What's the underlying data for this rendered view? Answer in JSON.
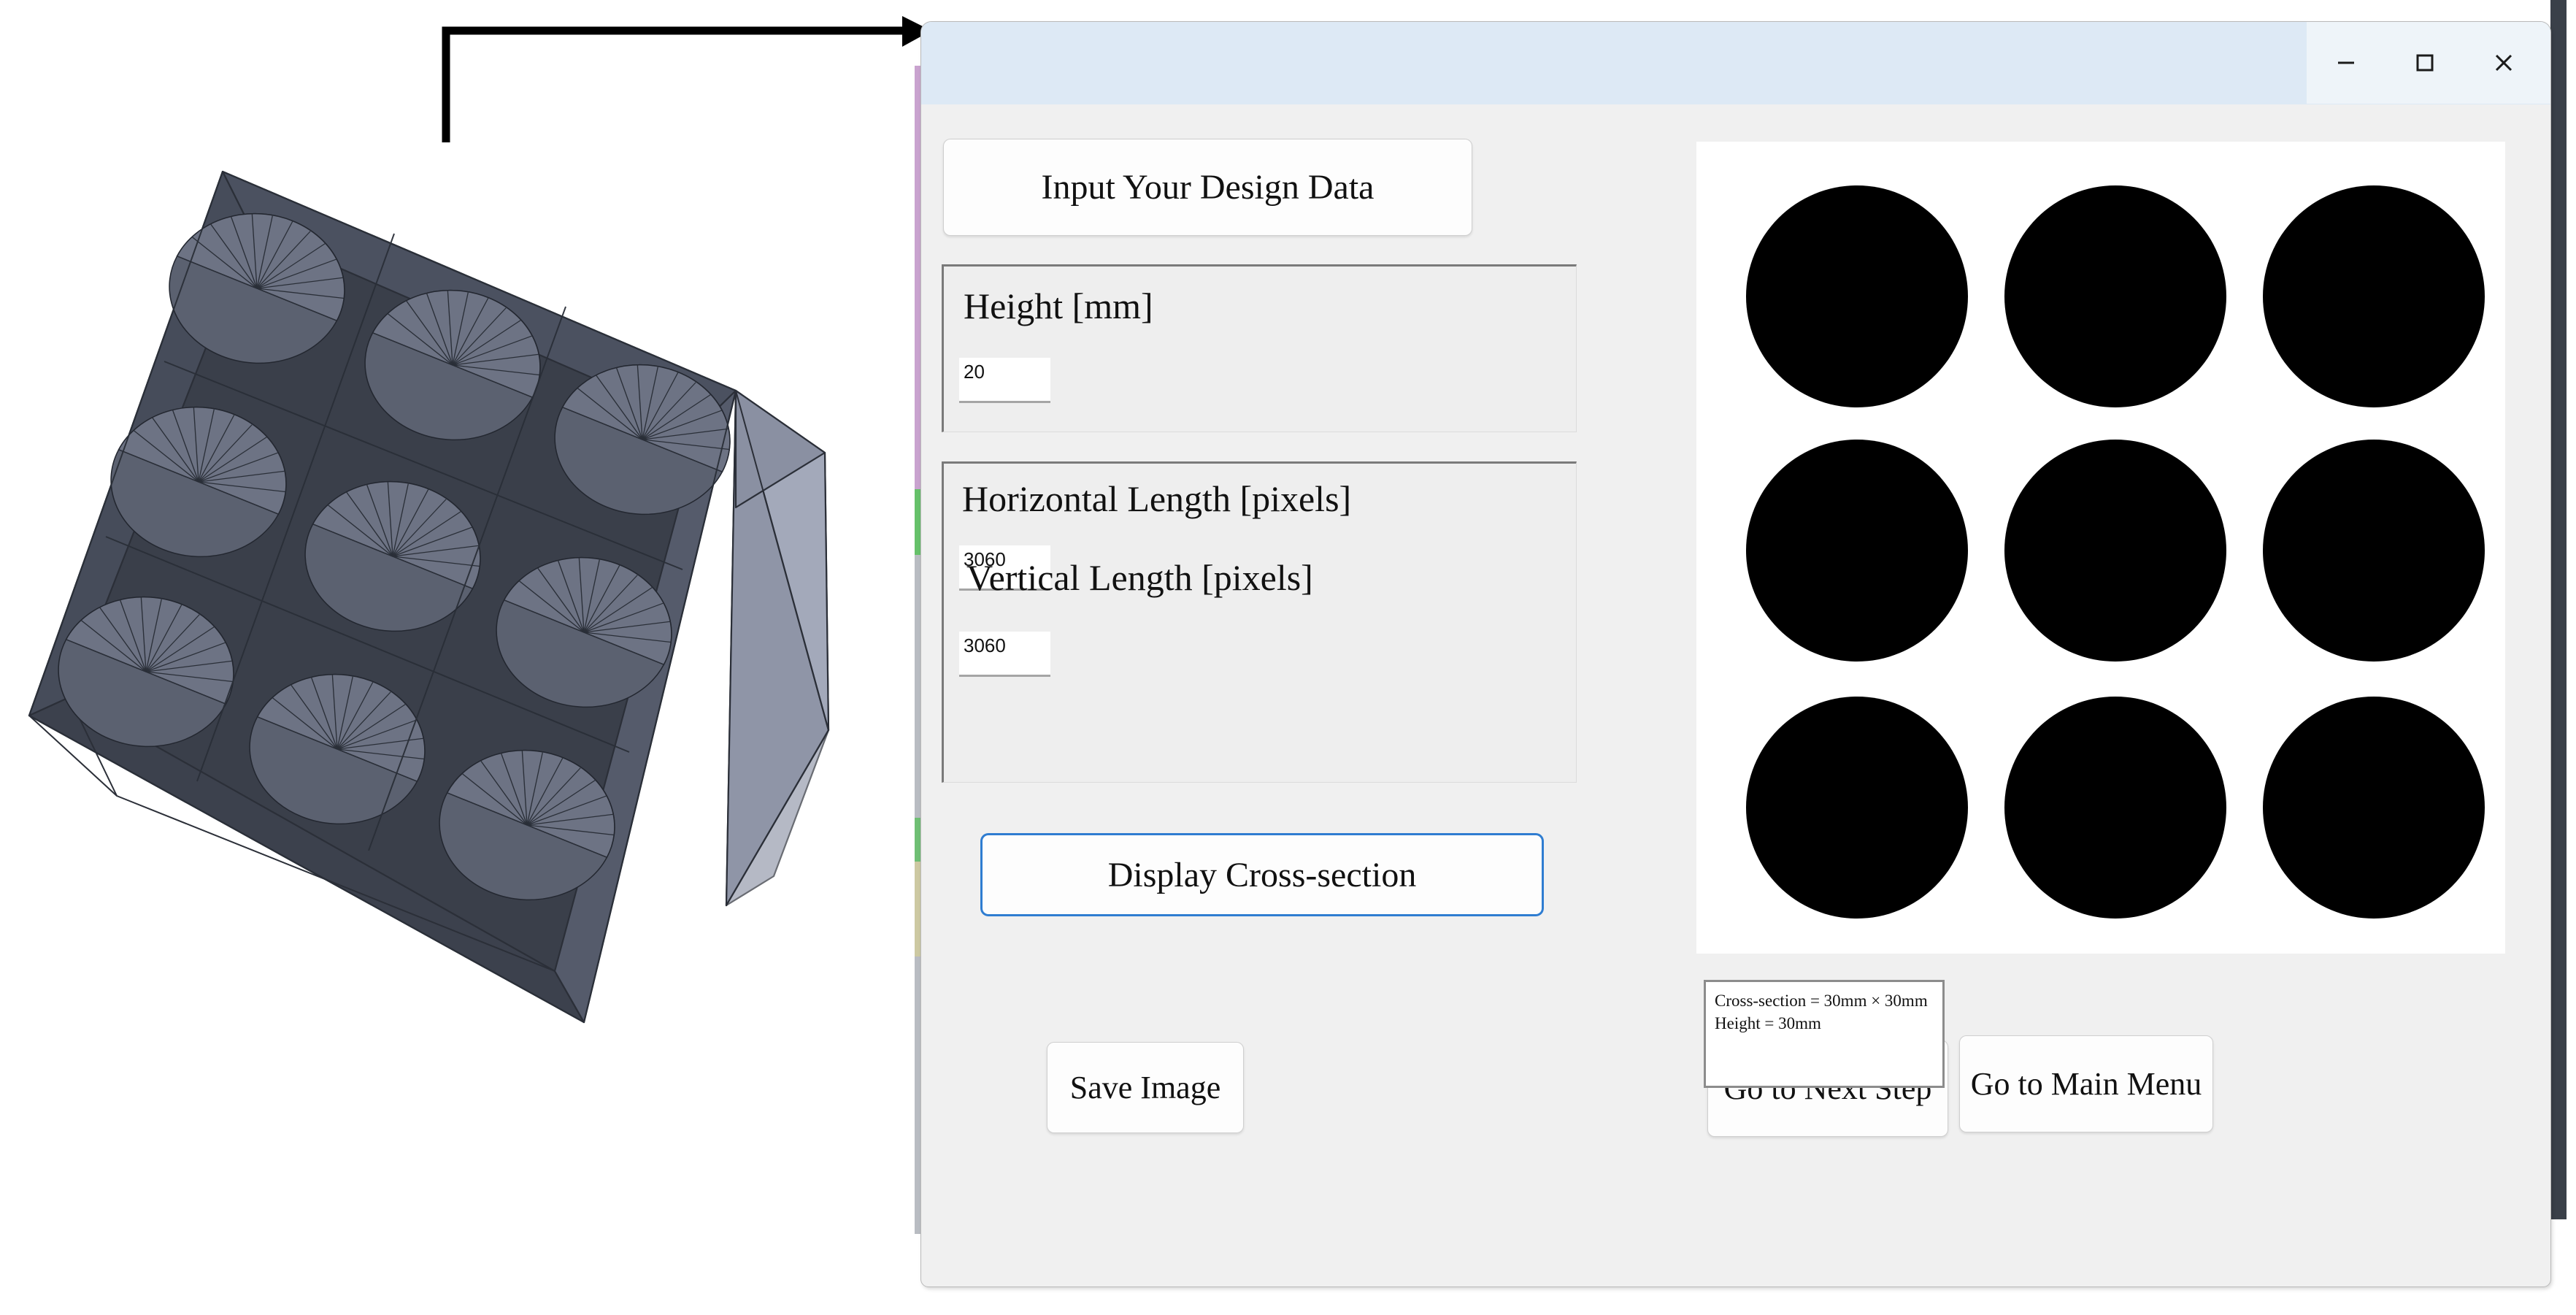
{
  "window": {
    "title": "",
    "controls": [
      {
        "name": "minimize",
        "glyph": "minimize-icon"
      },
      {
        "name": "maximize",
        "glyph": "maximize-icon"
      },
      {
        "name": "close",
        "glyph": "close-icon"
      }
    ]
  },
  "panel": {
    "header_button": "Input Your Design Data",
    "height_group": {
      "label": "Height [mm]",
      "value": "20"
    },
    "size_group": {
      "horizontal_label": "Horizontal Length [pixels]",
      "horizontal_value": "3060",
      "vertical_label": "Vertical Length [pixels]",
      "vertical_value": "3060"
    },
    "display_button": "Display Cross-section",
    "info": {
      "line1": "Cross-section = 30mm × 30mm",
      "line2": "Height = 30mm"
    },
    "actions": {
      "save": "Save Image",
      "next": "Go to Next Step",
      "main_menu": "Go to Main Menu"
    }
  },
  "pattern": {
    "description": "3x3 grid of filled black circles on white background",
    "rows": 3,
    "cols": 3,
    "fill_color": "#000000",
    "background_color": "#ffffff"
  },
  "figure": {
    "description": "3D CAD render of a rectangular block with a 3x3 array of hemispherical dimples on its top face",
    "shade_top": "#5a6070",
    "shade_side": "#8a90a2"
  },
  "colors": {
    "title_bar": "#dde9f5",
    "client_bg": "#f0f0f0",
    "focus_border": "#2f7dd1",
    "group_border": "#7a7a7a"
  }
}
